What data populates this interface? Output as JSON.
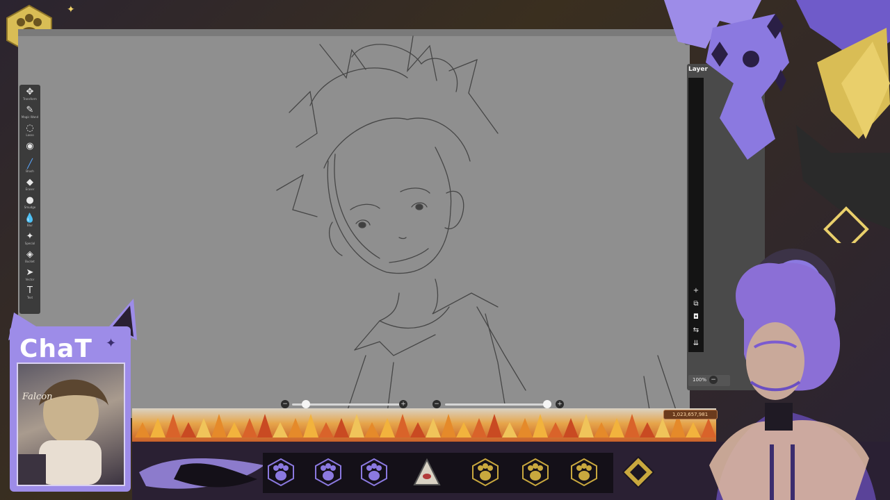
{
  "layer_panel": {
    "title": "Layer",
    "zoom": "100%"
  },
  "tools": [
    {
      "name": "move",
      "icon": "move-icon",
      "glyph": "✥",
      "label": "Transform"
    },
    {
      "name": "magic-wand",
      "icon": "magic-wand-icon",
      "glyph": "✎",
      "label": "Magic Wand"
    },
    {
      "name": "lasso",
      "icon": "lasso-icon",
      "glyph": "◌",
      "label": "Lasso"
    },
    {
      "name": "color",
      "icon": "color-picker-icon",
      "glyph": "◉",
      "label": ""
    },
    {
      "name": "brush",
      "icon": "brush-icon",
      "glyph": "╱",
      "label": "Brush"
    },
    {
      "name": "eraser",
      "icon": "eraser-icon",
      "glyph": "◆",
      "label": "Eraser"
    },
    {
      "name": "smudge",
      "icon": "smudge-icon",
      "glyph": "●",
      "label": "Smudge"
    },
    {
      "name": "blur",
      "icon": "blur-icon",
      "glyph": "💧",
      "label": "Blur"
    },
    {
      "name": "special",
      "icon": "special-icon",
      "glyph": "✦",
      "label": "Special"
    },
    {
      "name": "bucket",
      "icon": "bucket-icon",
      "glyph": "◈",
      "label": "Bucket"
    },
    {
      "name": "vector",
      "icon": "vector-icon",
      "glyph": "➤",
      "label": "Vector"
    },
    {
      "name": "text",
      "icon": "text-icon",
      "glyph": "T",
      "label": "Text"
    }
  ],
  "chat": {
    "title": "ChaT",
    "card_caption": "Falcon"
  },
  "counter": "1,023,657,981",
  "colors": {
    "canvas": "#8f8f8f",
    "purple": "#9d8ce8",
    "gold": "#c9a83e",
    "panel": "#4a4a4a"
  },
  "layer_buttons": [
    {
      "icon": "add-layer-icon",
      "glyph": "+"
    },
    {
      "icon": "duplicate-layer-icon",
      "glyph": "⧉"
    },
    {
      "icon": "camera-icon",
      "glyph": "◘"
    },
    {
      "icon": "flip-icon",
      "glyph": "⇆"
    },
    {
      "icon": "merge-down-icon",
      "glyph": "⇊"
    }
  ]
}
